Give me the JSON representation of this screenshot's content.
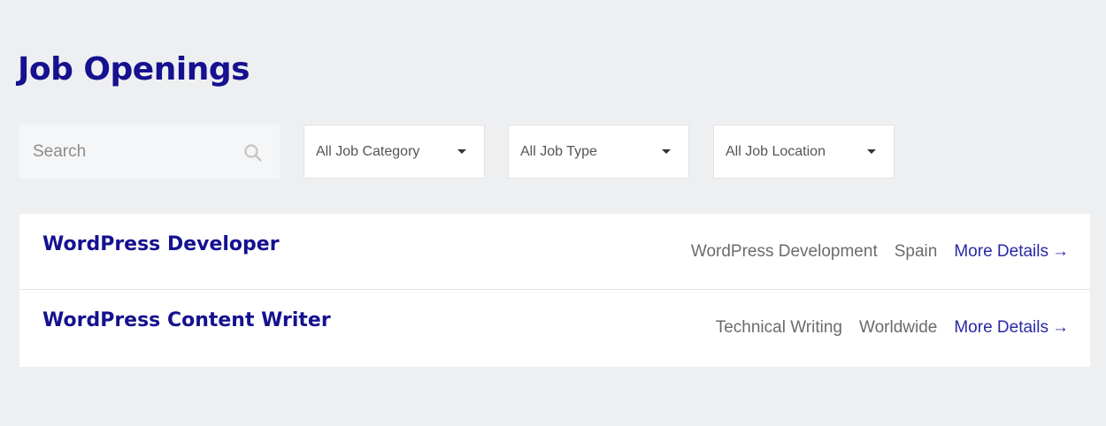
{
  "page": {
    "title": "Job Openings"
  },
  "filters": {
    "search_placeholder": "Search",
    "category": "All Job Category",
    "type": "All Job Type",
    "location": "All Job Location"
  },
  "jobs": [
    {
      "title": "WordPress Developer",
      "category": "WordPress Development",
      "location": "Spain",
      "link_label": "More Details",
      "arrow": "→"
    },
    {
      "title": "WordPress Content Writer",
      "category": "Technical Writing",
      "location": "Worldwide",
      "link_label": "More Details",
      "arrow": "→"
    }
  ],
  "colors": {
    "accent": "#15118f",
    "link": "#2a28a6",
    "background": "#eeeff1"
  },
  "icons": {
    "search": "search-icon",
    "dropdown": "caret-down-icon",
    "arrow": "arrow-right-icon"
  }
}
